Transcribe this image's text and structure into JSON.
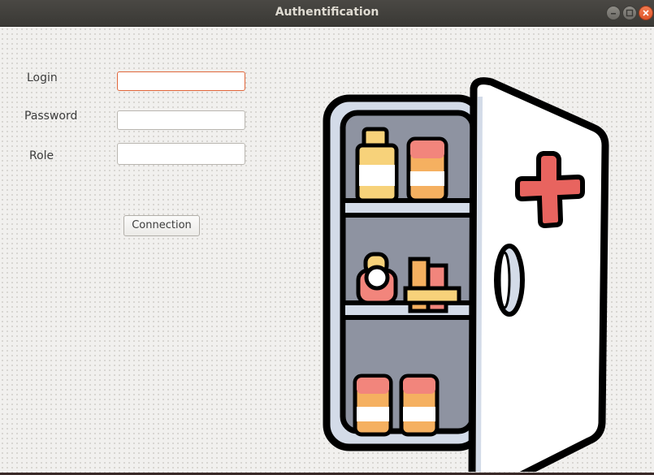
{
  "window": {
    "title": "Authentification",
    "controls": [
      "minimize-icon",
      "maximize-icon",
      "close-icon"
    ]
  },
  "form": {
    "login_label": "Login",
    "password_label": "Password",
    "role_label": "Role",
    "login_value": "",
    "password_value": "",
    "role_value": "",
    "submit_label": "Connection"
  },
  "illustration": {
    "name": "medicine-cabinet-icon",
    "colors": {
      "outline": "#000000",
      "cabinet_inner": "#8e93a1",
      "shelf": "#d3dbe8",
      "cross": "#e8645f",
      "bottle_yellow": "#f7d27a",
      "bottle_orange": "#f5b060",
      "bottle_pink": "#f2857c"
    }
  },
  "colors": {
    "focus_border": "#e0663a",
    "titlebar": "#3f3e3a",
    "close_button": "#e9602f"
  }
}
